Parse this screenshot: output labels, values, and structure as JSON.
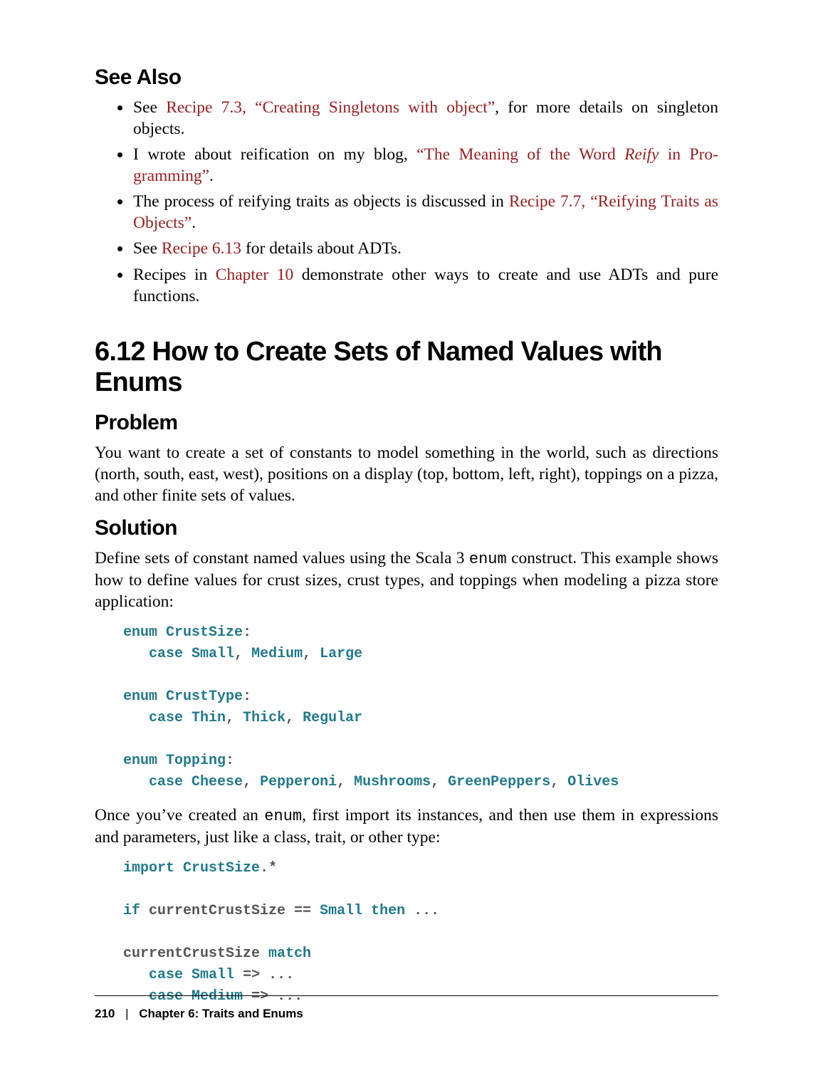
{
  "headings": {
    "see_also": "See Also",
    "section": "6.12 How to Create Sets of Named Values with Enums",
    "problem": "Problem",
    "solution": "Solution"
  },
  "see_also_items": {
    "i0_pre": "See ",
    "i0_link": "Recipe 7.3, “Creating Singletons with object”",
    "i0_post": ", for more details on singleton objects.",
    "i1_pre": "I wrote about reification on my blog, ",
    "i1_link_a": "“The Meaning of the Word ",
    "i1_link_ital": "Reify",
    "i1_link_b": " in Pro­gramming”",
    "i1_post": ".",
    "i2_pre": "The process of reifying traits as objects is discussed in ",
    "i2_link": "Recipe 7.7, “Reifying Traits as Objects”",
    "i2_post": ".",
    "i3_pre": "See ",
    "i3_link": "Recipe 6.13",
    "i3_post": " for details about ADTs.",
    "i4_pre": "Recipes in ",
    "i4_link": "Chapter 10",
    "i4_post": " demonstrate other ways to create and use ADTs and pure functions."
  },
  "problem_text": "You want to create a set of constants to model something in the world, such as direc­tions (north, south, east, west), positions on a display (top, bottom, left, right), top­pings on a pizza, and other finite sets of values.",
  "solution_para1_a": "Define sets of constant named values using the Scala 3 ",
  "solution_para1_code": "enum",
  "solution_para1_b": " construct. This example shows how to define values for crust sizes, crust types, and toppings when modeling a pizza store application:",
  "code1": {
    "l1_kw": "enum",
    "l1_tp": " CrustSize",
    "l1_pl": ":",
    "l2_in": "   ",
    "l2_kw": "case",
    "l2_sp": " ",
    "l2_a": "Small",
    "l2_c1": ", ",
    "l2_b": "Medium",
    "l2_c2": ", ",
    "l2_c": "Large",
    "l3_kw": "enum",
    "l3_tp": " CrustType",
    "l3_pl": ":",
    "l4_in": "   ",
    "l4_kw": "case",
    "l4_sp": " ",
    "l4_a": "Thin",
    "l4_c1": ", ",
    "l4_b": "Thick",
    "l4_c2": ", ",
    "l4_c": "Regular",
    "l5_kw": "enum",
    "l5_tp": " Topping",
    "l5_pl": ":",
    "l6_in": "   ",
    "l6_kw": "case",
    "l6_sp": " ",
    "l6_a": "Cheese",
    "l6_c1": ", ",
    "l6_b": "Pepperoni",
    "l6_c2": ", ",
    "l6_c": "Mushrooms",
    "l6_c3": ", ",
    "l6_d": "GreenPeppers",
    "l6_c4": ", ",
    "l6_e": "Olives"
  },
  "solution_para2_a": "Once you’ve created an ",
  "solution_para2_code": "enum",
  "solution_para2_b": ", first import its instances, and then use them in expres­sions and parameters, just like a class, trait, or other type:",
  "code2": {
    "l1_kw": "import",
    "l1_sp": " ",
    "l1_tp": "CrustSize",
    "l1_pl": ".*",
    "l2_kw": "if",
    "l2_pl_a": " currentCrustSize == ",
    "l2_tp": "Small",
    "l2_sp": " ",
    "l2_kw2": "then",
    "l2_pl_b": " ...",
    "l3_pl_a": "currentCrustSize ",
    "l3_kw": "match",
    "l4_in": "   ",
    "l4_kw": "case",
    "l4_sp": " ",
    "l4_tp": "Small",
    "l4_pl": " => ...",
    "l5_in": "   ",
    "l5_kw": "case",
    "l5_sp": " ",
    "l5_tp": "Medium",
    "l5_pl": " => ..."
  },
  "footer": {
    "page": "210",
    "sep": "|",
    "chapter": "Chapter 6: Traits and Enums"
  }
}
